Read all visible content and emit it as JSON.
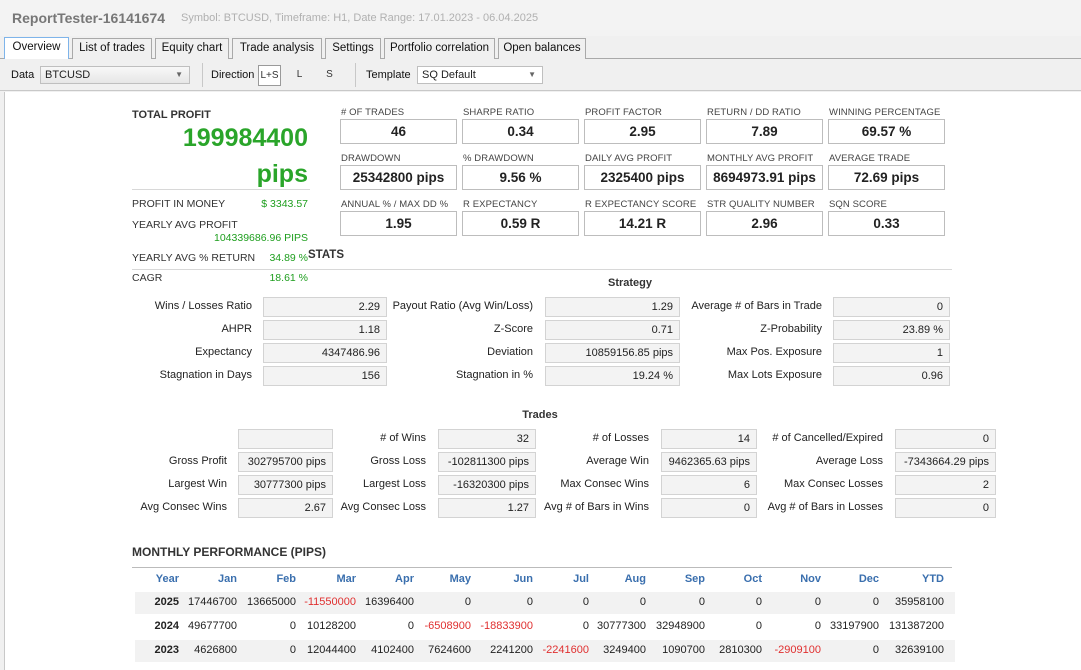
{
  "window": {
    "title": "ReportTester-16141674",
    "subtitle": "Symbol: BTCUSD, Timeframe: H1, Date Range: 17.01.2023 - 06.04.2025"
  },
  "tabs": [
    "Overview",
    "List of trades",
    "Equity chart",
    "Trade analysis",
    "Settings",
    "Portfolio correlation",
    "Open balances"
  ],
  "toolbar": {
    "data_label": "Data",
    "data_value": "BTCUSD",
    "direction_label": "Direction",
    "directions": [
      "L+S",
      "L",
      "S"
    ],
    "template_label": "Template",
    "template_value": "SQ Default"
  },
  "summary": {
    "total_profit_label": "TOTAL PROFIT",
    "total_profit_value": "199984400",
    "total_profit_unit": "pips",
    "profit_money_label": "PROFIT IN MONEY",
    "profit_money_value": "$ 3343.57",
    "yearly_avg_profit_label": "YEARLY AVG PROFIT",
    "yearly_avg_profit_value": "104339686.96 PIPS",
    "yearly_avg_return_label": "YEARLY AVG % RETURN",
    "yearly_avg_return_value": "34.89 %",
    "cagr_label": "CAGR",
    "cagr_value": "18.61 %"
  },
  "kpis": [
    {
      "label": "# OF TRADES",
      "value": "46"
    },
    {
      "label": "SHARPE RATIO",
      "value": "0.34"
    },
    {
      "label": "PROFIT FACTOR",
      "value": "2.95"
    },
    {
      "label": "RETURN / DD RATIO",
      "value": "7.89"
    },
    {
      "label": "WINNING PERCENTAGE",
      "value": "69.57 %"
    },
    {
      "label": "DRAWDOWN",
      "value": "25342800 pips"
    },
    {
      "label": "% DRAWDOWN",
      "value": "9.56 %"
    },
    {
      "label": "DAILY AVG PROFIT",
      "value": "2325400 pips"
    },
    {
      "label": "MONTHLY AVG PROFIT",
      "value": "8694973.91 pips"
    },
    {
      "label": "AVERAGE TRADE",
      "value": "72.69 pips"
    },
    {
      "label": "ANNUAL % / MAX DD %",
      "value": "1.95"
    },
    {
      "label": "R EXPECTANCY",
      "value": "0.59 R"
    },
    {
      "label": "R EXPECTANCY SCORE",
      "value": "14.21 R"
    },
    {
      "label": "STR QUALITY NUMBER",
      "value": "2.96"
    },
    {
      "label": "SQN SCORE",
      "value": "0.33"
    }
  ],
  "stats": {
    "title": "STATS",
    "strategy_title": "Strategy",
    "strategy": [
      {
        "label": "Wins / Losses Ratio",
        "value": "2.29"
      },
      {
        "label": "Payout Ratio (Avg Win/Loss)",
        "value": "1.29"
      },
      {
        "label": "Average # of Bars in Trade",
        "value": "0"
      },
      {
        "label": "AHPR",
        "value": "1.18"
      },
      {
        "label": "Z-Score",
        "value": "0.71"
      },
      {
        "label": "Z-Probability",
        "value": "23.89 %"
      },
      {
        "label": "Expectancy",
        "value": "4347486.96"
      },
      {
        "label": "Deviation",
        "value": "10859156.85 pips"
      },
      {
        "label": "Max Pos. Exposure",
        "value": "1"
      },
      {
        "label": "Stagnation in Days",
        "value": "156"
      },
      {
        "label": "Stagnation in %",
        "value": "19.24 %"
      },
      {
        "label": "Max Lots Exposure",
        "value": "0.96"
      }
    ],
    "trades_title": "Trades",
    "trades": [
      {
        "label": "",
        "value": ""
      },
      {
        "label": "# of Wins",
        "value": "32"
      },
      {
        "label": "# of Losses",
        "value": "14"
      },
      {
        "label": "# of Cancelled/Expired",
        "value": "0"
      },
      {
        "label": "Gross Profit",
        "value": "302795700 pips"
      },
      {
        "label": "Gross Loss",
        "value": "-102811300 pips"
      },
      {
        "label": "Average Win",
        "value": "9462365.63 pips"
      },
      {
        "label": "Average Loss",
        "value": "-7343664.29 pips"
      },
      {
        "label": "Largest Win",
        "value": "30777300 pips"
      },
      {
        "label": "Largest Loss",
        "value": "-16320300 pips"
      },
      {
        "label": "Max Consec Wins",
        "value": "6"
      },
      {
        "label": "Max Consec Losses",
        "value": "2"
      },
      {
        "label": "Avg Consec Wins",
        "value": "2.67"
      },
      {
        "label": "Avg Consec Loss",
        "value": "1.27"
      },
      {
        "label": "Avg # of Bars in Wins",
        "value": "0"
      },
      {
        "label": "Avg # of Bars in Losses",
        "value": "0"
      }
    ]
  },
  "monthly": {
    "title": "MONTHLY PERFORMANCE (PIPS)",
    "headers": [
      "Year",
      "Jan",
      "Feb",
      "Mar",
      "Apr",
      "May",
      "Jun",
      "Jul",
      "Aug",
      "Sep",
      "Oct",
      "Nov",
      "Dec",
      "YTD"
    ],
    "rows": [
      {
        "year": "2025",
        "values": [
          "17446700",
          "13665000",
          "-11550000",
          "16396400",
          "0",
          "0",
          "0",
          "0",
          "0",
          "0",
          "0",
          "0",
          "35958100"
        ]
      },
      {
        "year": "2024",
        "values": [
          "49677700",
          "0",
          "10128200",
          "0",
          "-6508900",
          "-18833900",
          "0",
          "30777300",
          "32948900",
          "0",
          "0",
          "33197900",
          "131387200"
        ]
      },
      {
        "year": "2023",
        "values": [
          "4626800",
          "0",
          "12044400",
          "4102400",
          "7624600",
          "2241200",
          "-2241600",
          "3249400",
          "1090700",
          "2810300",
          "-2909100",
          "0",
          "32639100"
        ]
      }
    ],
    "negative_color": "#e03030",
    "header_color": "#3a6fae"
  },
  "colors": {
    "profit_green": "#2aa52a",
    "tab_active_border": "#7eb4ea"
  }
}
